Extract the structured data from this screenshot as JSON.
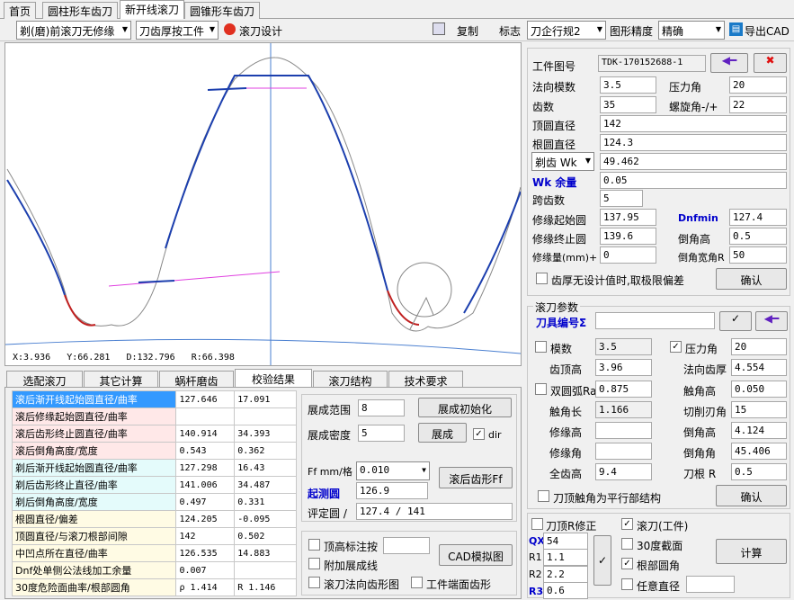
{
  "top_tabs": [
    "首页",
    "圆柱形车齿刀",
    "新开线滚刀",
    "圆锥形车齿刀"
  ],
  "toolbar": {
    "mode": "剃(磨)前滚刀无修缘",
    "thickness": "刀齿厚按工件",
    "design": "滚刀设计",
    "copy": "复制",
    "mark_label": "标志",
    "mark_value": "刀企行规2",
    "precision_label": "图形精度",
    "precision_value": "精确",
    "export": "导出CAD"
  },
  "canvas": {
    "status": {
      "x": "X:3.936",
      "y": "Y:66.281",
      "d": "D:132.796",
      "r": "R:66.398"
    }
  },
  "bottom_tabs": [
    "选配滚刀",
    "其它计算",
    "蜗杆磨齿",
    "校验结果",
    "滚刀结构",
    "技术要求"
  ],
  "results": [
    {
      "name": "滚后渐开线起始圆直径/曲率",
      "v1": "127.646",
      "v2": "17.091",
      "g": "r1"
    },
    {
      "name": "滚后修缘起始圆直径/曲率",
      "v1": "",
      "v2": "",
      "g": "r1"
    },
    {
      "name": "滚后齿形终止圆直径/曲率",
      "v1": "140.914",
      "v2": "34.393",
      "g": "r1"
    },
    {
      "name": "滚后倒角高度/宽度",
      "v1": "0.543",
      "v2": "0.362",
      "g": "r1"
    },
    {
      "name": "剃后渐开线起始圆直径/曲率",
      "v1": "127.298",
      "v2": "16.43",
      "g": "r2"
    },
    {
      "name": "剃后齿形终止直径/曲率",
      "v1": "141.006",
      "v2": "34.487",
      "g": "r2"
    },
    {
      "name": "剃后倒角高度/宽度",
      "v1": "0.497",
      "v2": "0.331",
      "g": "r2"
    },
    {
      "name": "根圆直径/偏差",
      "v1": "124.205",
      "v2": "-0.095",
      "g": "r3"
    },
    {
      "name": "顶圆直径/与滚刀根部间隙",
      "v1": "142",
      "v2": "0.502",
      "g": "r3"
    },
    {
      "name": "中凹点所在直径/曲率",
      "v1": "126.535",
      "v2": "14.883",
      "g": "r3"
    },
    {
      "name": "Dnf处单侧公法线加工余量",
      "v1": "0.007",
      "v2": "",
      "g": "r3"
    },
    {
      "name": "30度危险面曲率/根部圆角",
      "v1": "ρ  1.414",
      "v2": "R 1.146",
      "g": "r3"
    }
  ],
  "zhan": {
    "range_label": "展成范围",
    "range_value": "8",
    "init_btn": "展成初始化",
    "density_label": "展成密度",
    "density_value": "5",
    "zhan_btn": "展成",
    "dir": "dir",
    "ff_label": "Ff mm/格",
    "ff_value": "0.010",
    "ff_btn": "滚后齿形Ff",
    "measure_label": "起测圆",
    "measure_value": "126.9",
    "eval_label": "评定圆 /",
    "eval_value": "127.4 / 141"
  },
  "opts": {
    "tip_mark": "顶高标注按",
    "cad_btn": "CAD模拟图",
    "extra_zhan": "附加展成线",
    "hob_normal": "滚刀法向齿形图",
    "work_end": "工件端面齿形"
  },
  "workpiece": {
    "drawing_label": "工件图号",
    "drawing_value": "TDK-170152688-1",
    "module_label": "法向模数",
    "module_value": "3.5",
    "pressure_label": "压力角",
    "pressure_value": "20",
    "teeth_label": "齿数",
    "teeth_value": "35",
    "helix_label": "螺旋角-/+",
    "helix_value": "22",
    "tip_label": "顶圆直径",
    "tip_value": "142",
    "root_label": "根圆直径",
    "root_value": "124.3",
    "wk_combo": "剃齿 Wk",
    "wk_value": "49.462",
    "wk_margin_label": "Wk 余量",
    "wk_margin_value": "0.05",
    "span_label": "跨齿数",
    "span_value": "5",
    "mod_start_label": "修缘起始圆",
    "mod_start_value": "137.95",
    "dnfmin_label": "Dnfmin",
    "dnfmin_value": "127.4",
    "mod_end_label": "修缘终止圆",
    "mod_end_value": "139.6",
    "chamfer_h_label": "倒角高",
    "chamfer_h_value": "0.5",
    "mod_amt_label": "修缘量(mm)+",
    "mod_amt_value": "0",
    "chamfer_w_label": "倒角宽角R",
    "chamfer_w_value": "50",
    "limit_chk": "齿厚无设计值时,取极限偏差",
    "ok": "确认"
  },
  "hob": {
    "title": "滚刀参数",
    "code_label": "刀具编号Σ",
    "code_value": "",
    "module_chk": "模数",
    "module_value": "3.5",
    "pressure_chk": "压力角",
    "pressure_value": "20",
    "addendum_label": "齿顶高",
    "addendum_value": "3.96",
    "normal_thick_label": "法向齿厚",
    "normal_thick_value": "4.554",
    "double_arc": "双圆弧Ra",
    "double_arc_value": "0.875",
    "tip_h_label": "触角高",
    "tip_h_value": "0.050",
    "tip_len_label": "触角长",
    "tip_len_value": "1.166",
    "cut_angle_label": "切削刃角",
    "cut_angle_value": "15",
    "mod_h_label": "修缘高",
    "mod_h_value": "",
    "chamfer_h_label": "倒角高",
    "chamfer_h_value": "4.124",
    "mod_a_label": "修缘角",
    "mod_a_value": "",
    "chamfer_a_label": "倒角角",
    "chamfer_a_value": "45.406",
    "full_h_label": "全齿高",
    "full_h_value": "9.4",
    "root_r_label": "刀根 R",
    "root_r_value": "0.5",
    "parallel_chk": "刀顶触角为平行部结构",
    "ok": "确认"
  },
  "calc": {
    "tip_r": "刀顶R修正",
    "hob_work": "滚刀(工件)",
    "qx_label": "QX",
    "qx_value": "54",
    "r1_label": "R1",
    "r1_value": "1.1",
    "r2_label": "R2",
    "r2_value": "2.2",
    "r3_label": "R3",
    "r3_value": "0.6",
    "deg30": "30度截面",
    "root_fillet": "根部圆角",
    "any_dia": "任意直径",
    "calc_btn": "计算"
  }
}
